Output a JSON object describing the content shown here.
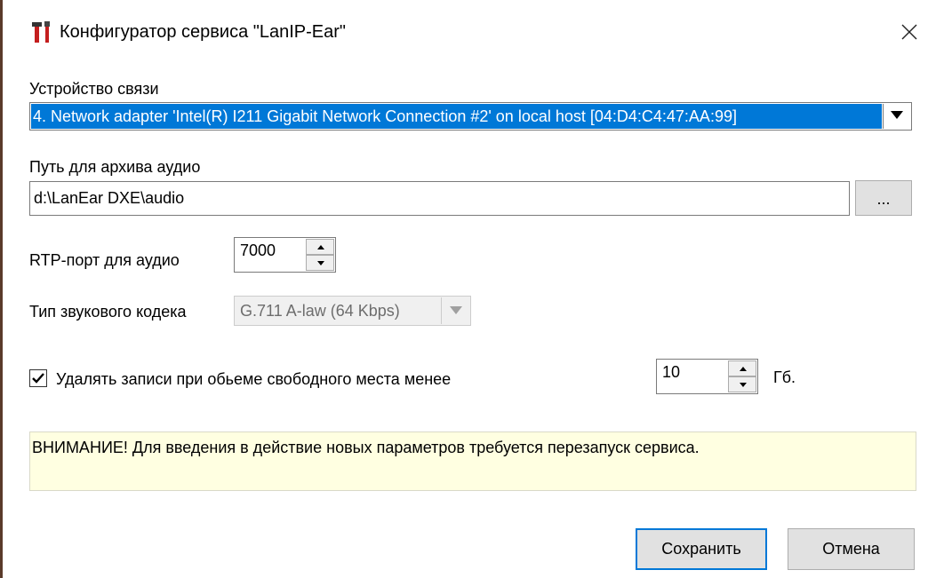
{
  "window": {
    "title": "Конфигуратор сервиса \"LanIP-Ear\"",
    "app_icon": "tools-icon",
    "close_icon": "close-icon"
  },
  "device": {
    "label": "Устройство связи",
    "selected": "4. Network adapter 'Intel(R) I211 Gigabit Network Connection #2' on local host [04:D4:C4:47:AA:99]"
  },
  "archive": {
    "label": "Путь для архива аудио",
    "path": "d:\\LanEar DXE\\audio",
    "browse_label": "..."
  },
  "rtp": {
    "label": "RTP-порт для аудио",
    "port": "7000"
  },
  "codec": {
    "label": "Тип звукового кодека",
    "selected": "G.711 A-law (64 Kbps)"
  },
  "cleanup": {
    "checked": true,
    "label": "Удалять записи при обьеме свободного места менее",
    "value": "10",
    "unit": "Гб."
  },
  "warning": {
    "text": "ВНИМАНИЕ! Для введения в действие новых параметров требуется перезапуск сервиса."
  },
  "buttons": {
    "save_label": "Сохранить",
    "cancel_label": "Отмена"
  },
  "colors": {
    "selection": "#0078d7",
    "warning_bg": "#ffffe1",
    "button_bg": "#e1e1e1"
  }
}
